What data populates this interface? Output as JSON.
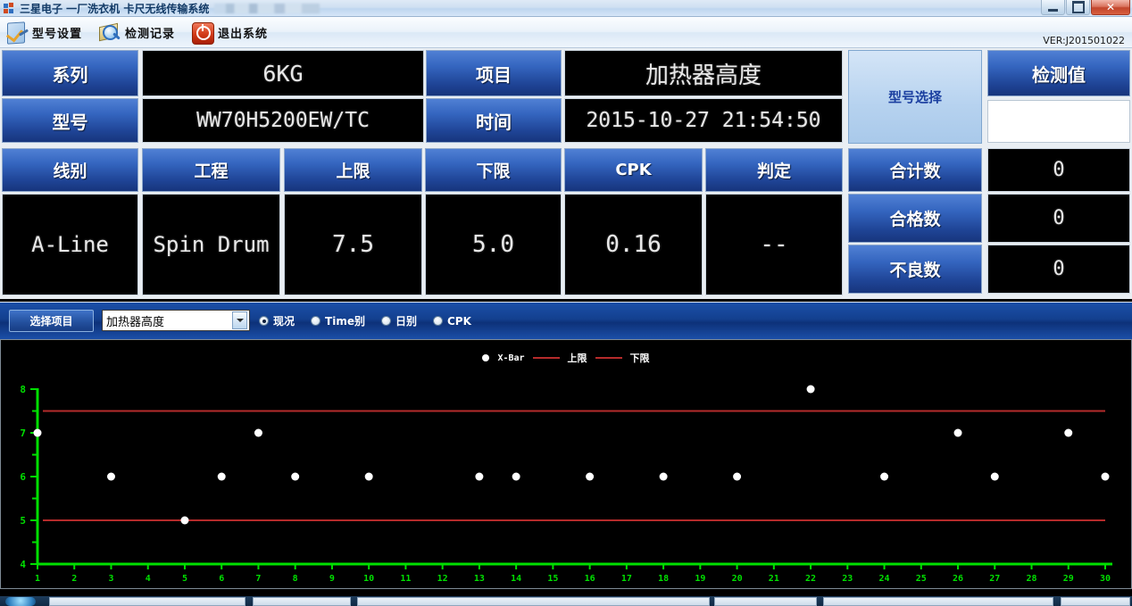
{
  "window": {
    "title": "三星电子 一厂洗衣机 卡尺无线传输系统",
    "minimize_label": "",
    "maximize_label": "",
    "close_label": "✕",
    "version": "VER:J201501022"
  },
  "toolbar": {
    "items": [
      {
        "label": "型号设置",
        "icon": "clipboard-check-icon"
      },
      {
        "label": "检测记录",
        "icon": "magnifier-record-icon"
      },
      {
        "label": "退出系统",
        "icon": "power-off-icon"
      }
    ]
  },
  "panel": {
    "series_label": "系列",
    "series_value": "6KG",
    "item_label": "项目",
    "item_value": "加热器高度",
    "model_label": "型号",
    "model_value": "WW70H5200EW/TC",
    "time_label": "时间",
    "time_value": "2015-10-27 21:54:50",
    "model_select_label": "型号选择",
    "measure_label": "检测值",
    "measure_value": "",
    "line_label": "线别",
    "line_value": "A-Line",
    "process_label": "工程",
    "process_value": "Spin Drum",
    "usl_label": "上限",
    "usl_value": "7.5",
    "lsl_label": "下限",
    "lsl_value": "5.0",
    "cpk_label": "CPK",
    "cpk_value": "0.16",
    "judge_label": "判定",
    "judge_value": "--",
    "total_label": "合计数",
    "total_value": "0",
    "pass_label": "合格数",
    "pass_value": "0",
    "fail_label": "不良数",
    "fail_value": "0"
  },
  "controls": {
    "select_button": "选择项目",
    "combo_value": "加热器高度",
    "combo_arrow": "▼",
    "radios": [
      {
        "label": "现况",
        "selected": true
      },
      {
        "label": "Time别",
        "selected": false
      },
      {
        "label": "日别",
        "selected": false
      },
      {
        "label": "CPK",
        "selected": false
      }
    ]
  },
  "colors": {
    "header_blue_top": "#5080d4",
    "header_blue_bottom": "#17357c",
    "chart_bg": "#000000",
    "axis_green": "#00e000",
    "limit_red": "#b52b2b",
    "point_white": "#ffffff",
    "select_bar_blue": "#13408f"
  },
  "chart_data": {
    "type": "scatter",
    "title": "",
    "xlabel": "",
    "ylabel": "",
    "xlim": [
      1,
      30
    ],
    "ylim": [
      4,
      8
    ],
    "yticks": [
      4,
      5,
      6,
      7,
      8
    ],
    "yminor": [
      4.5,
      5.5,
      6.5,
      7.5
    ],
    "xticks": [
      1,
      2,
      3,
      4,
      5,
      6,
      7,
      8,
      9,
      10,
      11,
      12,
      13,
      14,
      15,
      16,
      17,
      18,
      19,
      20,
      21,
      22,
      23,
      24,
      25,
      26,
      27,
      28,
      29,
      30
    ],
    "grid": false,
    "legend_position": "top-center",
    "legend": [
      {
        "label": "X-Bar",
        "marker": "dot",
        "color": "#ffffff"
      },
      {
        "label": "上限",
        "marker": "line",
        "color": "#b52b2b"
      },
      {
        "label": "下限",
        "marker": "line",
        "color": "#b52b2b"
      }
    ],
    "control_lines": [
      {
        "name": "上限",
        "value": 7.5,
        "color": "#b52b2b"
      },
      {
        "name": "下限",
        "value": 5.0,
        "color": "#b52b2b"
      }
    ],
    "series": [
      {
        "name": "X-Bar",
        "color": "#ffffff",
        "points": [
          {
            "x": 1,
            "y": 7
          },
          {
            "x": 3,
            "y": 6
          },
          {
            "x": 5,
            "y": 5
          },
          {
            "x": 6,
            "y": 6
          },
          {
            "x": 7,
            "y": 7
          },
          {
            "x": 8,
            "y": 6
          },
          {
            "x": 10,
            "y": 6
          },
          {
            "x": 13,
            "y": 6
          },
          {
            "x": 14,
            "y": 6
          },
          {
            "x": 16,
            "y": 6
          },
          {
            "x": 18,
            "y": 6
          },
          {
            "x": 20,
            "y": 6
          },
          {
            "x": 22,
            "y": 8
          },
          {
            "x": 24,
            "y": 6
          },
          {
            "x": 26,
            "y": 7
          },
          {
            "x": 27,
            "y": 6
          },
          {
            "x": 29,
            "y": 7
          },
          {
            "x": 30,
            "y": 6
          }
        ]
      }
    ]
  }
}
